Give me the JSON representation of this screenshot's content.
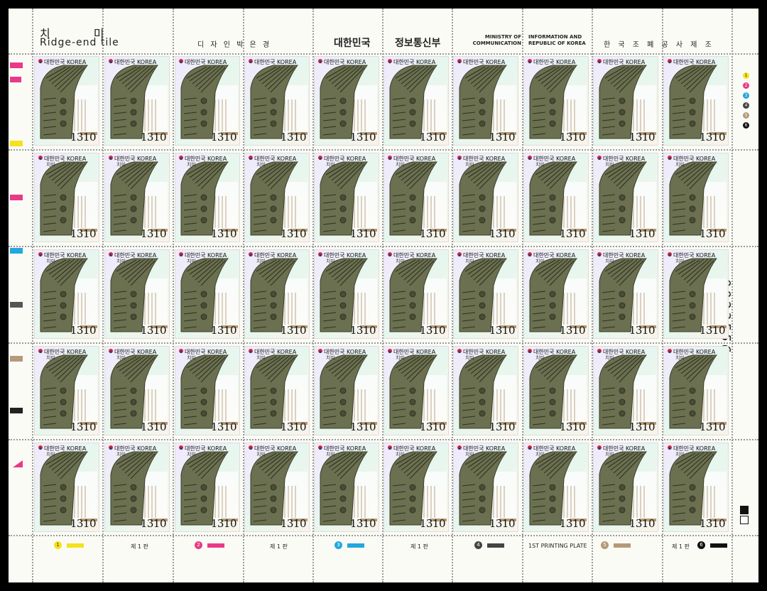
{
  "header": {
    "title_ko": "치 미",
    "title_en": "Ridge-end tile",
    "designer": "디 자 인 박 은 경",
    "country_ko": "대한민국",
    "ministry_ko": "정보통신부",
    "ministry_en_1": "MINISTRY OF COMMUNICATION",
    "ministry_en_2": "INFORMATION AND REPUBLIC OF KOREA",
    "printer": "한 국 조 폐 공 사 제 조"
  },
  "stamp": {
    "country_label": "대한민국 KOREA",
    "subtitle": "치미",
    "value": "1310",
    "rows": 5,
    "cols": 10
  },
  "serial_number": "0023556",
  "bottom": {
    "plate_labels": [
      "제 1 판",
      "제 1 판",
      "1ST PRINTING PLATE",
      "제 1 판"
    ],
    "color_numbers": [
      "1",
      "2",
      "3",
      "4",
      "5",
      "6"
    ]
  },
  "colors": {
    "yellow": "#f4e21a",
    "magenta": "#e83a86",
    "cyan": "#23a7de",
    "black": "#222222",
    "brown": "#b49a78",
    "tile_green": "#6b7050"
  }
}
